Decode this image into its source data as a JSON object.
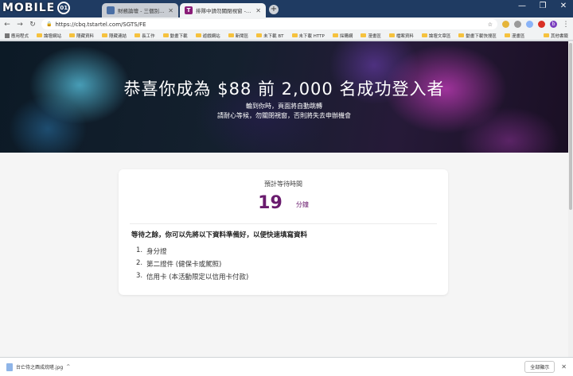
{
  "browser": {
    "logo": {
      "text": "MOBILE",
      "badge": "01"
    },
    "tabs": [
      {
        "title": "財務論壇 - 三個別家聯合來台研... ",
        "favicon_color": "#4a6fa5",
        "favicon_glyph": "",
        "active": false
      },
      {
        "title": "排隊中請勿關閉視窗 - 台灣之星",
        "favicon_color": "#8a1d78",
        "favicon_glyph": "T",
        "active": true
      }
    ],
    "new_tab_label": "+",
    "window_controls": [
      "—",
      "❐",
      "✕"
    ],
    "nav": {
      "back": "←",
      "forward": "→",
      "reload": "↻"
    },
    "url": "https://cbq.tstartel.com/SGTS/FE",
    "lock_icon": "🔒",
    "star_icon": "☆",
    "menu_icon": "⋮",
    "avatar_letter": "b",
    "extension_colors": [
      "#e5b53a",
      "#9a9a9a",
      "#8ab4f8",
      "#d93025",
      "#5f6368"
    ]
  },
  "bookmarks": {
    "items": [
      {
        "label": "應用程式",
        "kind": "apps"
      },
      {
        "label": "論壇網站",
        "kind": "folder"
      },
      {
        "label": "隱藏資料",
        "kind": "folder"
      },
      {
        "label": "隱藏連結",
        "kind": "folder"
      },
      {
        "label": "長工作",
        "kind": "folder"
      },
      {
        "label": "動畫下載",
        "kind": "folder"
      },
      {
        "label": "遊戲網站",
        "kind": "folder"
      },
      {
        "label": "新聞區",
        "kind": "folder"
      },
      {
        "label": "未下載 BT",
        "kind": "folder"
      },
      {
        "label": "未下載 HTTP",
        "kind": "folder"
      },
      {
        "label": "採購網",
        "kind": "folder"
      },
      {
        "label": "漫畫區",
        "kind": "folder"
      },
      {
        "label": "檔案資料",
        "kind": "folder"
      },
      {
        "label": "論壇文章區",
        "kind": "folder"
      },
      {
        "label": "動畫下載快搜區",
        "kind": "folder"
      },
      {
        "label": "漫畫區",
        "kind": "folder"
      }
    ],
    "other": "其他書籤"
  },
  "hero": {
    "title": "恭喜你成為 $88 前 2,000 名成功登入者",
    "line1": "輪到你時，頁面將自動跳轉",
    "line2": "請耐心等候，勿關閉視窗，否則將失去申辦機會"
  },
  "queue": {
    "label": "預計等待時間",
    "minutes": "19",
    "unit": "分鐘",
    "prep_title": "等待之餘，你可以先將以下資料準備好，以便快速填寫資料",
    "requirements": [
      {
        "index": "1.",
        "text": "身分證"
      },
      {
        "index": "2.",
        "text": "第二證件 (健保卡或駕照)"
      },
      {
        "index": "3.",
        "text": "信用卡 (本活動限定以信用卡付款)"
      }
    ]
  },
  "downloads": {
    "file_name": "台亡侍之酉成烷嗟.jpg",
    "caret": "^",
    "show_all": "全部顯示",
    "close": "✕"
  }
}
